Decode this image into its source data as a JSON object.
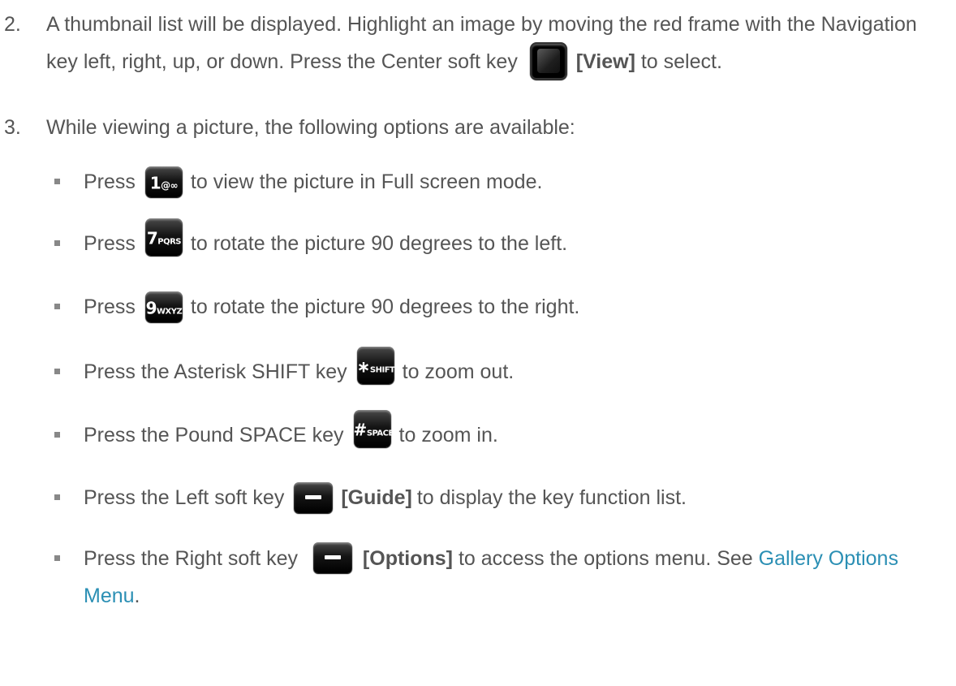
{
  "step2": {
    "number": "2.",
    "text_a": "A thumbnail list will be displayed. Highlight an image by moving the red frame with the Navigation key left, right, up, or down. Press the Center soft key",
    "view_label": "[View]",
    "text_b": "to select."
  },
  "step3": {
    "number": "3.",
    "text": "While viewing a picture, the following options are available:"
  },
  "bullets": [
    {
      "pre": "Press",
      "post": "to view the picture in Full screen mode.",
      "key_main": "1",
      "key_sub": "@∞"
    },
    {
      "pre": "Press",
      "post": "to rotate the picture 90 degrees to the left.",
      "key_main": "7",
      "key_sub": "PQRS"
    },
    {
      "pre": "Press",
      "post": "to rotate the picture 90 degrees to the right.",
      "key_main": "9",
      "key_sub": "WXYZ"
    },
    {
      "pre": "Press the Asterisk SHIFT key",
      "post": "to zoom out.",
      "key_main": "∗",
      "key_sub": "SHIFT"
    },
    {
      "pre": "Press the Pound SPACE key",
      "post": "to zoom in.",
      "key_main": "#",
      "key_sub": "SPACE"
    },
    {
      "pre": "Press the Left soft key",
      "label": "[Guide]",
      "post": "to display the key function list."
    },
    {
      "pre": "Press the Right soft key",
      "label": "[Options]",
      "post": "to access the options menu. See",
      "link": "Gallery Options Menu",
      "end": "."
    }
  ]
}
